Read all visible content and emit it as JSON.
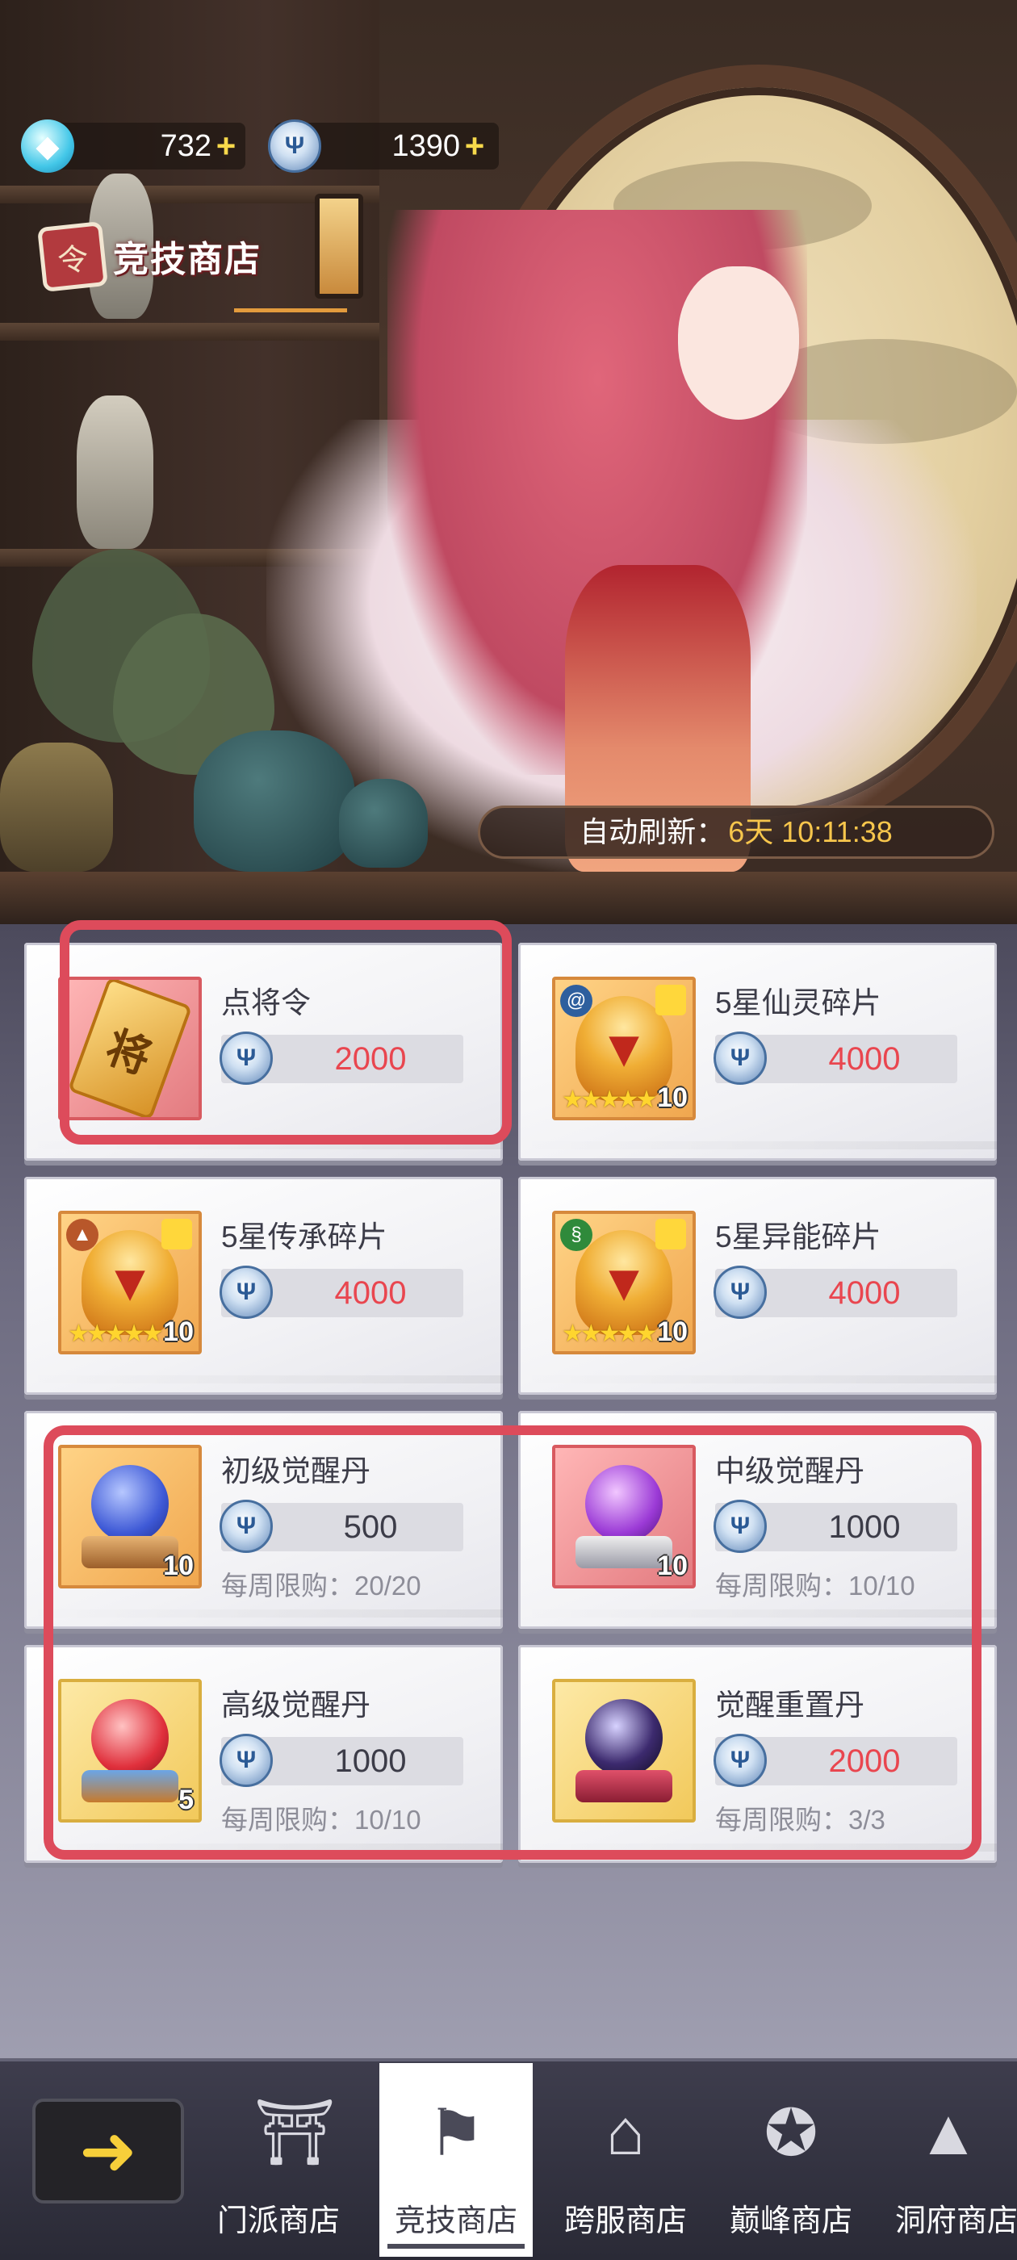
{
  "currency": {
    "gems": {
      "icon": "diamond-icon",
      "value": "732"
    },
    "arena_coin": {
      "icon": "trident-coin-icon",
      "value": "1390"
    }
  },
  "shop": {
    "title": "竞技商店",
    "badge_glyph": "令",
    "refresh_label": "自动刷新：",
    "refresh_value": "6天 10:11:38"
  },
  "items": [
    {
      "name": "点将令",
      "price": "2000",
      "price_color": "red",
      "icon": "general-token-icon",
      "frame": "pink",
      "glyph": "将"
    },
    {
      "name": "5星仙灵碎片",
      "price": "4000",
      "price_color": "red",
      "icon": "golden-helmet-fragment-icon",
      "frame": "gold",
      "qty": "10",
      "stars": "★★★★★",
      "type_icon": "spiral-icon"
    },
    {
      "name": "5星传承碎片",
      "price": "4000",
      "price_color": "red",
      "icon": "golden-helmet-fragment-icon",
      "frame": "gold",
      "qty": "10",
      "stars": "★★★★★",
      "type_icon": "pagoda-icon"
    },
    {
      "name": "5星异能碎片",
      "price": "4000",
      "price_color": "red",
      "icon": "golden-helmet-fragment-icon",
      "frame": "gold",
      "qty": "10",
      "stars": "★★★★★",
      "type_icon": "dna-icon"
    },
    {
      "name": "初级觉醒丹",
      "price": "500",
      "price_color": "dark",
      "icon": "blue-orb-icon",
      "frame": "gold",
      "qty": "10",
      "limit": "每周限购：20/20"
    },
    {
      "name": "中级觉醒丹",
      "price": "1000",
      "price_color": "dark",
      "icon": "purple-orb-icon",
      "frame": "pink",
      "qty": "10",
      "limit": "每周限购：10/10"
    },
    {
      "name": "高级觉醒丹",
      "price": "1000",
      "price_color": "dark",
      "icon": "red-orb-icon",
      "frame": "yellow",
      "qty": "5",
      "limit": "每周限购：10/10"
    },
    {
      "name": "觉醒重置丹",
      "price": "2000",
      "price_color": "red",
      "icon": "dark-orb-icon",
      "frame": "yellow",
      "limit": "每周限购：3/3"
    }
  ],
  "nav": {
    "back_icon": "back-arrow-icon",
    "tabs": [
      {
        "label": "门派商店",
        "icon": "sect-gate-icon"
      },
      {
        "label": "竞技商店",
        "icon": "arena-banner-icon",
        "active": true
      },
      {
        "label": "跨服商店",
        "icon": "cross-server-hall-icon"
      },
      {
        "label": "巅峰商店",
        "icon": "peak-emblem-icon"
      },
      {
        "label": "洞府商店",
        "icon": "cave-mountain-icon"
      }
    ]
  },
  "colors": {
    "highlight": "#dd4b5b",
    "price_red": "#e9464f",
    "timer_yellow": "#f7c64c",
    "plus_yellow": "#f7d94b"
  }
}
